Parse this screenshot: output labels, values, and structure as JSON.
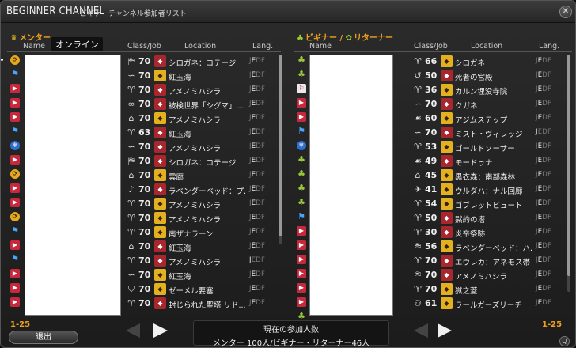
{
  "title": "BEGINNER CHANNEL",
  "subtitle": "ビギナーチャンネル参加者リスト",
  "close_label": "✕",
  "left": {
    "panel_title": "メンター",
    "tooltip": "オンライン",
    "headers": {
      "name": "Name",
      "class_job": "Class/Job",
      "location": "Location",
      "lang": "Lang."
    },
    "status_icons": [
      "yel",
      "blue",
      "red",
      "red",
      "red",
      "blue",
      "bluec",
      "red",
      "yel",
      "red",
      "red",
      "yel",
      "blue",
      "red",
      "blue",
      "red",
      "red",
      "red"
    ],
    "rows": [
      {
        "job": "⛿",
        "lvl": "70",
        "loc_ic": "red",
        "loc": "シロガネ：コテージ",
        "lang_on": "E"
      },
      {
        "job": "∽",
        "lvl": "70",
        "loc_ic": "yel",
        "loc": "紅玉海",
        "lang_on": "E"
      },
      {
        "job": "♈",
        "lvl": "70",
        "loc_ic": "red",
        "loc": "アメノミハシラ",
        "lang_on": "E"
      },
      {
        "job": "∞",
        "lvl": "70",
        "loc_ic": "red",
        "loc": "被検世界「シグマ」...",
        "lang_on": "E"
      },
      {
        "job": "⌂",
        "lvl": "70",
        "loc_ic": "yel",
        "loc": "アメノミハシラ",
        "lang_on": "E"
      },
      {
        "job": "♈",
        "lvl": "63",
        "loc_ic": "red",
        "loc": "紅玉海",
        "lang_on": "E"
      },
      {
        "job": "∽",
        "lvl": "70",
        "loc_ic": "red",
        "loc": "アメノミハシラ",
        "lang_on": "E"
      },
      {
        "job": "⛿",
        "lvl": "70",
        "loc_ic": "red",
        "loc": "シロガネ：コテージ",
        "lang_on": "E"
      },
      {
        "job": "⌂",
        "lvl": "70",
        "loc_ic": "yel",
        "loc": "雲廊",
        "lang_on": "E"
      },
      {
        "job": "♪",
        "lvl": "70",
        "loc_ic": "red",
        "loc": "ラベンダーベッド：プ...",
        "lang_on": "E"
      },
      {
        "job": "♈",
        "lvl": "70",
        "loc_ic": "yel",
        "loc": "アメノミハシラ",
        "lang_on": "E"
      },
      {
        "job": "♈",
        "lvl": "70",
        "loc_ic": "yel",
        "loc": "アメノミハシラ",
        "lang_on": "E"
      },
      {
        "job": "♈",
        "lvl": "70",
        "loc_ic": "yel",
        "loc": "南ザナラーン",
        "lang_on": "E"
      },
      {
        "job": "⌂",
        "lvl": "70",
        "loc_ic": "red",
        "loc": "紅玉海",
        "lang_on": "E"
      },
      {
        "job": "♈",
        "lvl": "70",
        "loc_ic": "red",
        "loc": "アメノミハシラ",
        "lang_on": "J"
      },
      {
        "job": "∽",
        "lvl": "70",
        "loc_ic": "yel",
        "loc": "紅玉海",
        "lang_on": "E"
      },
      {
        "job": "⛉",
        "lvl": "70",
        "loc_ic": "yel",
        "loc": "ゼーメル要塞",
        "lang_on": "E"
      },
      {
        "job": "♈",
        "lvl": "70",
        "loc_ic": "red",
        "loc": "封じられた聖塔 リド...",
        "lang_on": "E"
      }
    ]
  },
  "right": {
    "panel_title_a": "ビギナー",
    "panel_sep": " / ",
    "panel_title_b": "リターナー",
    "headers": {
      "name": "Name",
      "class_job": "Class/Job",
      "location": "Location",
      "lang": "Lang."
    },
    "status_icons": [
      "grn",
      "grn",
      "whi",
      "red",
      "red",
      "blue",
      "bluec",
      "grn",
      "grn",
      "grn",
      "grn",
      "blue",
      "red",
      "red",
      "red",
      "red",
      "red",
      "red",
      "grn"
    ],
    "rows": [
      {
        "job": "♈",
        "lvl": "66",
        "loc_ic": "yel",
        "loc": "シロガネ",
        "lang_on": "E"
      },
      {
        "job": "↺",
        "lvl": "50",
        "loc_ic": "red",
        "loc": "死者の宮殿",
        "lang_on": "E"
      },
      {
        "job": "♈",
        "lvl": "36",
        "loc_ic": "yel",
        "loc": "カルン埋没寺院",
        "lang_on": "E"
      },
      {
        "job": "∽",
        "lvl": "70",
        "loc_ic": "red",
        "loc": "クガネ",
        "lang_on": "E"
      },
      {
        "job": "☙",
        "lvl": "60",
        "loc_ic": "yel",
        "loc": "アジムステップ",
        "lang_on": "E"
      },
      {
        "job": "∽",
        "lvl": "70",
        "loc_ic": "red",
        "loc": "ミスト・ヴィレッジ",
        "lang_on": "J"
      },
      {
        "job": "♈",
        "lvl": "53",
        "loc_ic": "yel",
        "loc": "ゴールドソーサー",
        "lang_on": "E"
      },
      {
        "job": "☙",
        "lvl": "49",
        "loc_ic": "red",
        "loc": "モードゥナ",
        "lang_on": "E"
      },
      {
        "job": "⌂",
        "lvl": "45",
        "loc_ic": "yel",
        "loc": "黒衣森：南部森林",
        "lang_on": "E"
      },
      {
        "job": "✈",
        "lvl": "41",
        "loc_ic": "yel",
        "loc": "ウルダハ：ナル回廊",
        "lang_on": "E"
      },
      {
        "job": "♈",
        "lvl": "54",
        "loc_ic": "yel",
        "loc": "ゴブレットビュート",
        "lang_on": "E"
      },
      {
        "job": "♈",
        "lvl": "50",
        "loc_ic": "red",
        "loc": "黙約の塔",
        "lang_on": "E"
      },
      {
        "job": "♈",
        "lvl": "30",
        "loc_ic": "red",
        "loc": "炎帝祭跡",
        "lang_on": "E"
      },
      {
        "job": "⛿",
        "lvl": "56",
        "loc_ic": "yel",
        "loc": "ラベンダーベッド：ハ...",
        "lang_on": "E"
      },
      {
        "job": "♈",
        "lvl": "70",
        "loc_ic": "red",
        "loc": "エウレカ：アネモス帯",
        "lang_on": "E"
      },
      {
        "job": "⛿",
        "lvl": "70",
        "loc_ic": "red",
        "loc": "アメノミハシラ",
        "lang_on": "E"
      },
      {
        "job": "♈",
        "lvl": "70",
        "loc_ic": "yel",
        "loc": "獄之蓋",
        "lang_on": "E"
      },
      {
        "job": "⚇",
        "lvl": "61",
        "loc_ic": "yel",
        "loc": "ラールガーズリーチ",
        "lang_on": "E"
      }
    ]
  },
  "bottom": {
    "left_range": "1-25",
    "right_range": "1-25",
    "exit_label": "退出",
    "info_title": "現在の参加人数",
    "info_count": "メンター 100人/ビギナー・リターナー46人",
    "zoom_label": "Q"
  }
}
